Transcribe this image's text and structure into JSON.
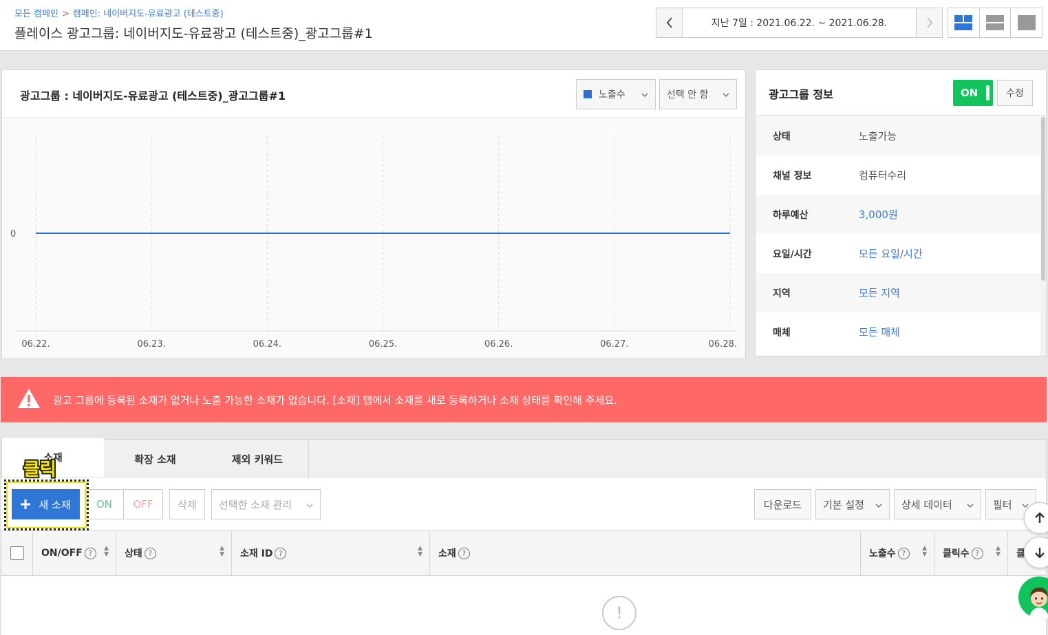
{
  "breadcrumb": {
    "root": "모든 캠페인",
    "separator": ">",
    "campaign": "캠페인: 네이버지도-유료광고 (테스트중)"
  },
  "page_title": "플레이스 광고그룹:  네이버지도-유료광고 (테스트중)_광고그룹#1",
  "date_range": {
    "text": "지난 7일 : 2021.06.22. ~ 2021.06.28."
  },
  "chart_panel": {
    "title": "광고그룹 : 네이버지도-유료광고 (테스트중)_광고그룹#1",
    "metric1": "노출수",
    "metric2": "선택 안 함"
  },
  "chart_data": {
    "type": "line",
    "x": [
      "06.22.",
      "06.23.",
      "06.24.",
      "06.25.",
      "06.26.",
      "06.27.",
      "06.28."
    ],
    "series": [
      {
        "name": "노출수",
        "values": [
          0,
          0,
          0,
          0,
          0,
          0,
          0
        ]
      }
    ],
    "y_ticks": [
      "0"
    ],
    "color": "#2e6fd0",
    "grid": true
  },
  "info_panel": {
    "title": "광고그룹 정보",
    "toggle": "ON",
    "edit": "수정",
    "rows": [
      {
        "label": "상태",
        "value": "노출가능"
      },
      {
        "label": "채널 정보",
        "value": "컴퓨터수리"
      },
      {
        "label": "하루예산",
        "value": "3,000원"
      },
      {
        "label": "요일/시간",
        "value": "모든 요일/시간"
      },
      {
        "label": "지역",
        "value": "모든 지역"
      },
      {
        "label": "매체",
        "value": "모든 매체"
      }
    ]
  },
  "alert": {
    "text": "광고 그룹에 등록된 소재가 없거나 노출 가능한 소재가 없습니다. [소재] 탭에서 소재를 새로 등록하거나 소재 상태를 확인해 주세요."
  },
  "tabs": [
    "소재",
    "확장 소재",
    "제외 키워드"
  ],
  "annotation": "클릭",
  "toolbar": {
    "new": "새 소재",
    "on": "ON",
    "off": "OFF",
    "delete": "삭제",
    "manage": "선택한 소재 관리",
    "download": "다운로드",
    "default_settings": "기본 설정",
    "detail_data": "상세 데이터",
    "filter": "필터"
  },
  "table": {
    "columns": [
      "ON/OFF",
      "상태",
      "소재 ID",
      "소재",
      "노출수",
      "클릭수",
      "클"
    ]
  },
  "colors": {
    "accent": "#2e77d6",
    "on_green": "#11c35b",
    "alert_red": "#fe6967"
  }
}
